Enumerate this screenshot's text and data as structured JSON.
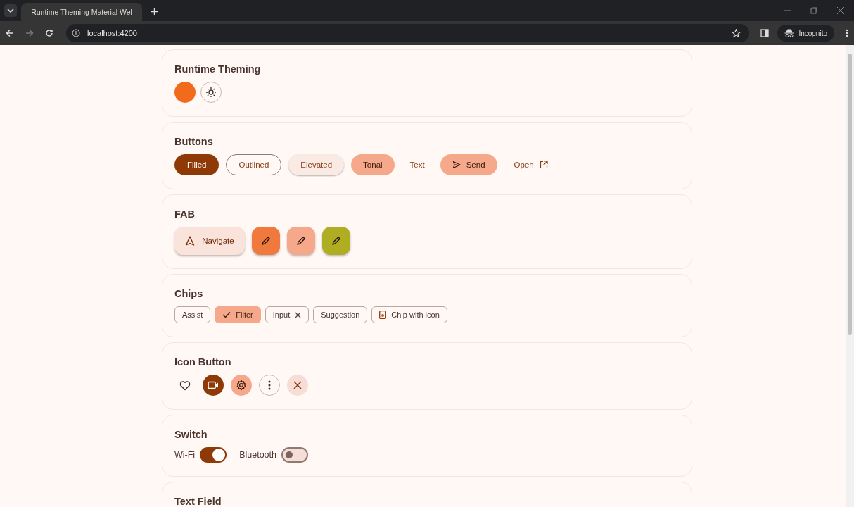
{
  "browser": {
    "tab_title": "Runtime Theming Material Wel",
    "url": "localhost:4200",
    "profile": "Incognito"
  },
  "sections": [
    {
      "kind": "theming",
      "title": "Runtime Theming"
    },
    {
      "kind": "buttons",
      "title": "Buttons",
      "items": [
        {
          "kind": "filled",
          "label": "Filled"
        },
        {
          "kind": "outlined",
          "label": "Outlined"
        },
        {
          "kind": "elevated",
          "label": "Elevated"
        },
        {
          "kind": "tonal",
          "label": "Tonal"
        },
        {
          "kind": "text",
          "label": "Text"
        },
        {
          "kind": "tonal_send",
          "label": "Send"
        },
        {
          "kind": "text_link",
          "label": "Open"
        }
      ]
    },
    {
      "kind": "fab",
      "title": "FAB",
      "items": [
        {
          "kind": "extended",
          "label": "Navigate"
        },
        {
          "kind": "primary"
        },
        {
          "kind": "secondary"
        },
        {
          "kind": "tertiary"
        }
      ]
    },
    {
      "kind": "chips",
      "title": "Chips",
      "items": [
        {
          "kind": "assist",
          "label": "Assist",
          "selected": false
        },
        {
          "kind": "filter",
          "label": "Filter",
          "selected": true
        },
        {
          "kind": "input",
          "label": "Input",
          "selected": false
        },
        {
          "kind": "suggestion",
          "label": "Suggestion",
          "selected": false
        },
        {
          "kind": "assist_icon",
          "label": "Chip with icon",
          "selected": false
        }
      ]
    },
    {
      "kind": "icon_buttons",
      "title": "Icon Button",
      "items": [
        {
          "kind": "standard"
        },
        {
          "kind": "filled"
        },
        {
          "kind": "tonal"
        },
        {
          "kind": "outlined"
        },
        {
          "kind": "close"
        }
      ]
    },
    {
      "kind": "switches",
      "title": "Switch",
      "items": [
        {
          "label": "Wi-Fi",
          "on": true
        },
        {
          "label": "Bluetooth",
          "on": false
        }
      ]
    },
    {
      "kind": "text_field",
      "title": "Text Field"
    }
  ]
}
